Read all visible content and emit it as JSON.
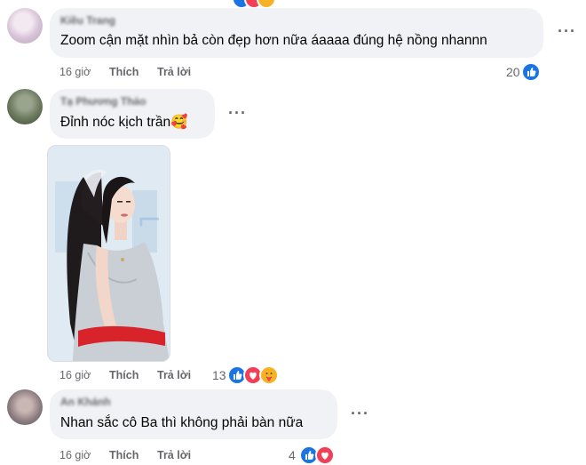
{
  "comments": [
    {
      "author": "Kiều Trang",
      "text": "Zoom cận mặt nhìn bả còn đẹp hơn nữa áaaaa đúng hệ nồng nhannn",
      "time": "16 giờ",
      "like_label": "Thích",
      "reply_label": "Trả lời",
      "reaction_count": "20",
      "reactions": [
        "like-icon"
      ]
    },
    {
      "author": "Tạ Phương Thảo",
      "text": "Đỉnh nóc kịch trần🥰",
      "time": "16 giờ",
      "like_label": "Thích",
      "reply_label": "Trả lời",
      "reaction_count": "13",
      "reactions": [
        "like-icon",
        "love-icon",
        "care-icon"
      ],
      "has_photo": true
    },
    {
      "author": "An Khánh",
      "text": "Nhan sắc cô Ba thì không phải bàn nữa",
      "time": "16 giờ",
      "like_label": "Thích",
      "reply_label": "Trả lời",
      "reaction_count": "4",
      "reactions": [
        "like-icon",
        "love-icon"
      ]
    }
  ],
  "colors": {
    "bubble": "#f0f2f5",
    "meta_text": "#65676b",
    "like_blue": "#1b74e4",
    "love_red": "#f33e58",
    "care_yellow": "#f7b125"
  }
}
